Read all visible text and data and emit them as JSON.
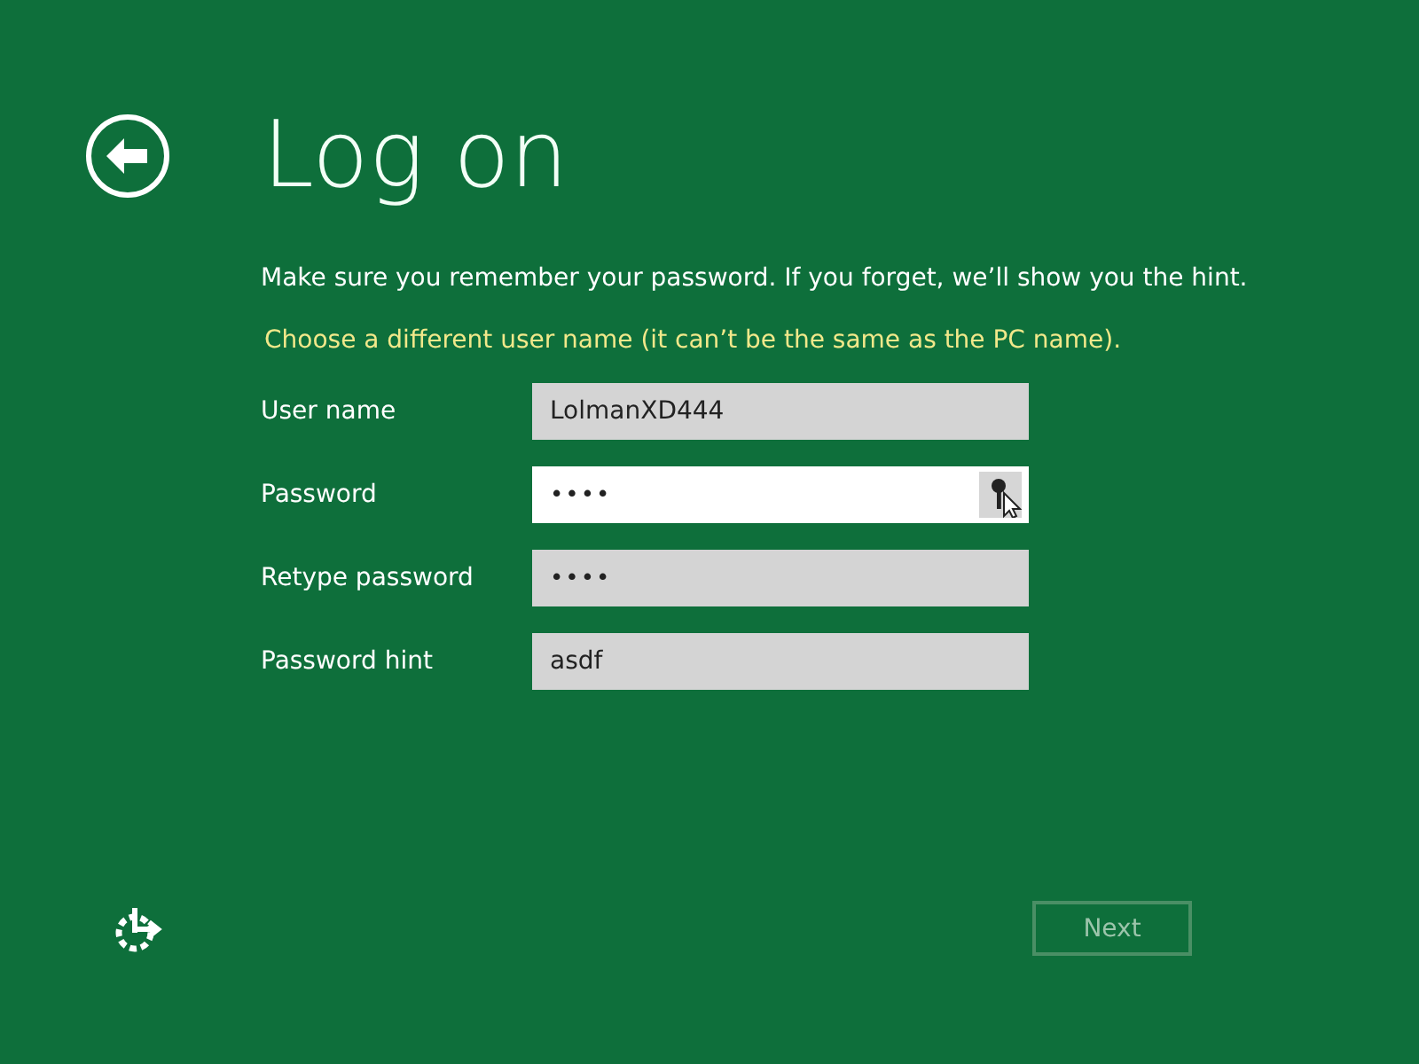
{
  "title": "Log on",
  "instructions": "Make sure you remember your password. If you forget, we’ll show you the hint.",
  "error": "Choose a different user name (it can’t be the same as the PC name).",
  "fields": [
    {
      "label": "User name",
      "value": "LolmanXD444",
      "kind": "text",
      "focused": false
    },
    {
      "label": "Password",
      "value": "••••",
      "kind": "password",
      "focused": true
    },
    {
      "label": "Retype password",
      "value": "••••",
      "kind": "password",
      "focused": false
    },
    {
      "label": "Password hint",
      "value": "asdf",
      "kind": "text",
      "focused": false
    }
  ],
  "next_button": {
    "label": "Next",
    "disabled": true
  }
}
